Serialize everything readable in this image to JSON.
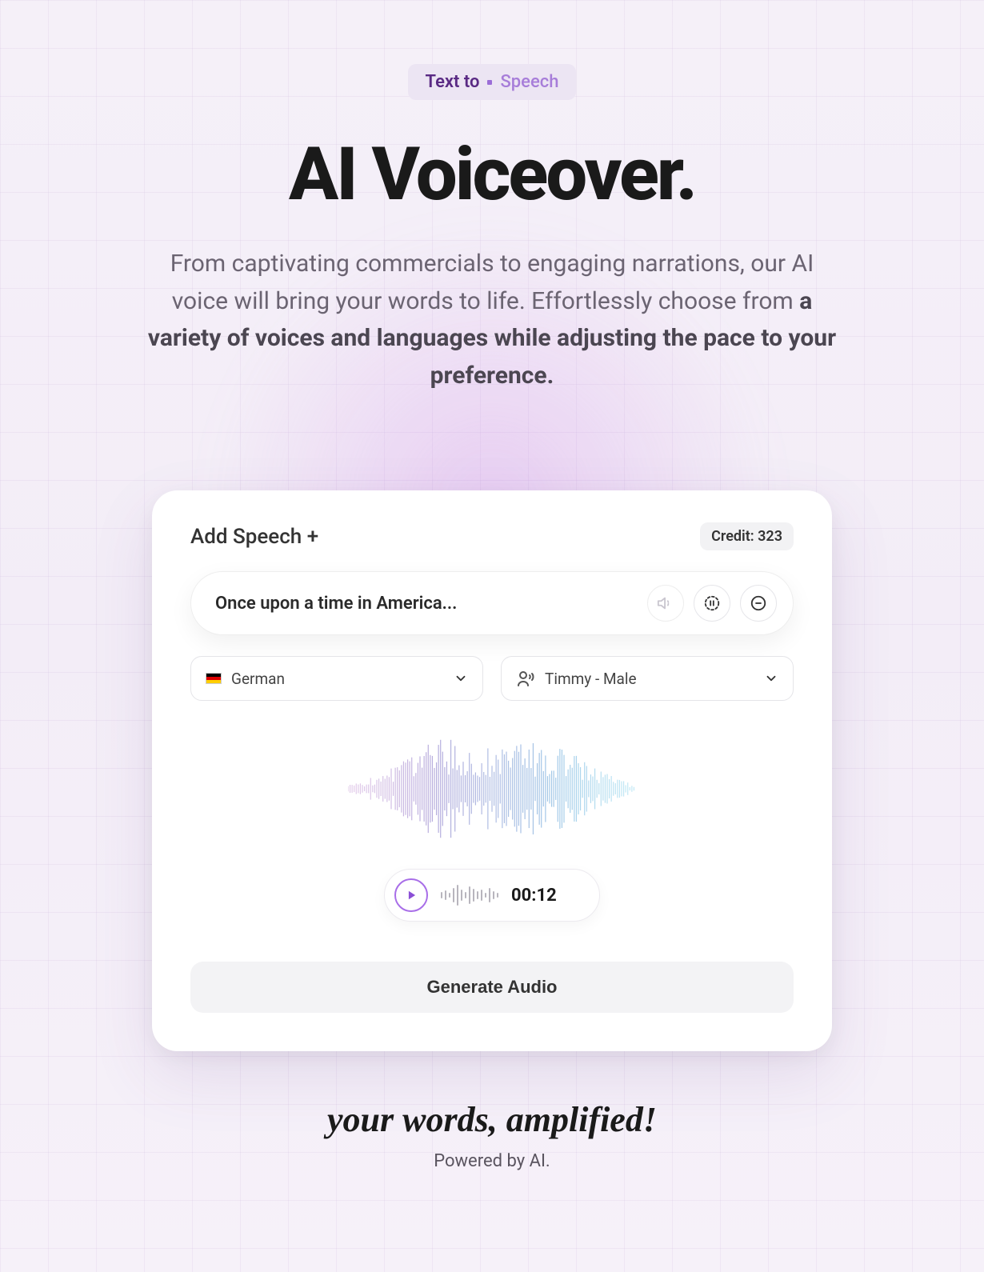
{
  "badge": {
    "prefix": "Text to",
    "suffix": "Speech"
  },
  "title": "AI Voiceover.",
  "subtitle": {
    "plain": "From captivating commercials to engaging narrations, our AI voice will bring your words to life. Effortlessly choose from ",
    "bold": "a variety of voices and languages while adjusting the pace to your preference."
  },
  "card": {
    "add_speech": "Add Speech +",
    "credit_label": "Credit: 323",
    "text_value": "Once upon a time in America...",
    "language": "German",
    "voice": "Timmy - Male",
    "time": "00:12",
    "generate": "Generate Audio"
  },
  "footer": {
    "tagline": "your words, amplified!",
    "powered": "Powered by AI."
  }
}
